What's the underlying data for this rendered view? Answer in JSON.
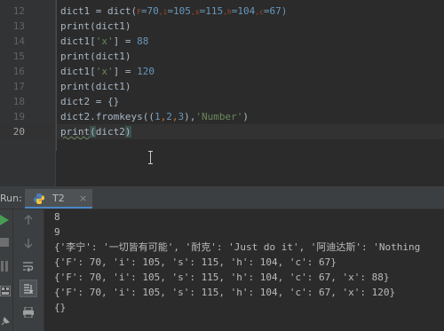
{
  "editor": {
    "lines": [
      {
        "num": "12"
      },
      {
        "num": "13"
      },
      {
        "num": "14"
      },
      {
        "num": "15"
      },
      {
        "num": "16"
      },
      {
        "num": "17"
      },
      {
        "num": "18"
      },
      {
        "num": "19"
      },
      {
        "num": "20"
      }
    ],
    "code": {
      "l12a": "dict1 = dict(",
      "l12b": "F",
      "l12c": "=70",
      "l12d": ",i",
      "l12e": "=105",
      "l12f": ",s",
      "l12g": "=115",
      "l12h": ",h",
      "l12i": "=104",
      "l12j": ",c",
      "l12k": "=67)",
      "l13": "print(dict1)",
      "l14a": "dict1[",
      "l14b": "'x'",
      "l14c": "] = ",
      "l14d": "88",
      "l15": "print(dict1)",
      "l16a": "dict1[",
      "l16b": "'x'",
      "l16c": "] = ",
      "l16d": "120",
      "l17": "print(dict1)",
      "l18a": "dict2 = ",
      "l18b": "{}",
      "l19a": "dict2.fromkeys((",
      "l19b": "1",
      "l19c": ",",
      "l19d": "2",
      "l19e": ",",
      "l19f": "3",
      "l19g": "),",
      "l19h": "'Number'",
      "l19i": ")",
      "l20a": "print",
      "l20b": "(",
      "l20c": "dict2",
      "l20d": ")"
    }
  },
  "run_panel": {
    "label": "Run:",
    "tab_name": "T2",
    "tab_close": "×",
    "output": [
      "8",
      "9",
      "{'李宁': '一切皆有可能', '耐克': 'Just do it', '阿迪达斯': 'Nothing",
      "{'F': 70, 'i': 105, 's': 115, 'h': 104, 'c': 67}",
      "{'F': 70, 'i': 105, 's': 115, 'h': 104, 'c': 67, 'x': 88}",
      "{'F': 70, 'i': 105, 's': 115, 'h': 104, 'c': 67, 'x': 120}",
      "{}"
    ]
  },
  "icons": {
    "run": "play-icon",
    "stop": "stop-icon",
    "up": "arrow-up-icon",
    "down": "arrow-down-icon",
    "wrap": "soft-wrap-icon",
    "scroll": "scroll-to-end-icon",
    "print": "print-icon",
    "layout": "layout-icon",
    "pin": "pin-icon",
    "python": "python-icon"
  },
  "colors": {
    "background": "#2b2b2b",
    "number": "#6897bb",
    "string": "#6a8759",
    "run_green": "#499c54",
    "text": "#a9b7c6"
  }
}
